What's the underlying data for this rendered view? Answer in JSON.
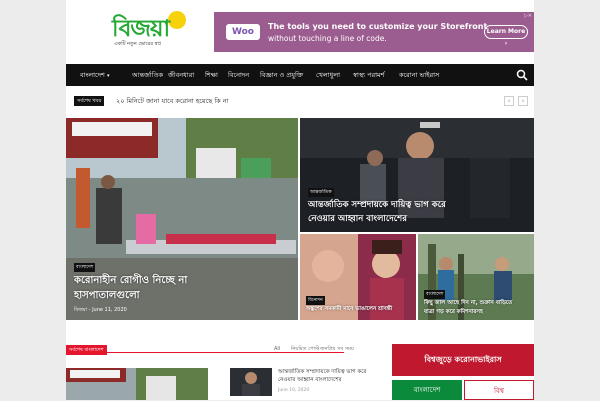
{
  "header": {
    "logo_text": "বিজয়া",
    "tagline": "একটি নতুন ভোরের স্বপ্ন"
  },
  "ad": {
    "logo": "Woo",
    "title": "The tools you need to customize your Storefront",
    "subtitle": "without touching a line of code.",
    "button": "Learn More",
    "colors": {
      "background": "#9b5c8f"
    }
  },
  "nav": {
    "items": [
      {
        "label": "বাংলাদেশ"
      },
      {
        "label": "আন্তর্জাতিক"
      },
      {
        "label": "জীবনধারা"
      },
      {
        "label": "শিক্ষা"
      },
      {
        "label": "বিনোদন"
      },
      {
        "label": "বিজ্ঞান ও প্রযুক্তি"
      },
      {
        "label": "খেলাধুলা"
      },
      {
        "label": "স্বাস্থ্য পরামর্শ"
      },
      {
        "label": "করোনা ভাইরাস"
      }
    ],
    "search_icon": "search-icon"
  },
  "ticker": {
    "label": "সর্বশেষ খবর",
    "text": "২০ মিনিটে জানা যাবে করোনা হয়েছে কি না",
    "prev": "‹",
    "next": "›"
  },
  "hero": {
    "main": {
      "category": "বাংলাদেশ",
      "title_line1": "করোনাহীন রোগীও নিচ্ছে না",
      "title_line2": "হাসপাতালগুলো",
      "meta": "বিজয়া - June 11, 2020",
      "banner": "বিজয়া"
    },
    "top_right": {
      "category": "আন্তর্জাতিক",
      "title_line1": "আন্তর্জাতিক সম্প্রদায়কে দায়িত্ব ভাগ করে",
      "title_line2": "নেওয়ার আহ্বান বাংলাদেশের"
    },
    "small1": {
      "category": "বিনোদন",
      "title": "অঙ্কুশের সমকামী মানে ভাঙালেন শ্রাবন্তী"
    },
    "small2": {
      "category": "বাংলাদেশ",
      "title_line1": "কিছু জাল আছে দিন না, শুক্রান বাড়িতে",
      "title_line2": "যাত্রা গড় করে কমিশনারসহ"
    }
  },
  "section": {
    "label": "সর্বশেষ বাংলাদেশ",
    "tabs": [
      "All",
      "নিয়মিত পোস্ট",
      "জনপ্রিয় সব সময়"
    ],
    "story": {
      "title_line1": "আন্তর্জাতিক সম্প্রদায়কে দায়িত্ব ভাগ করে",
      "title_line2": "নেওয়ার আহ্বান বাংলাদেশের",
      "date": "June 10, 2020"
    }
  },
  "corona": {
    "heading": "বিশ্বজুড়ে করোনাভাইরাস",
    "tab_bd": "বাংলাদেশ",
    "tab_world": "বিশ্ব",
    "colors": {
      "accent": "#c0182f",
      "tab_active": "#0a8a3a"
    }
  }
}
